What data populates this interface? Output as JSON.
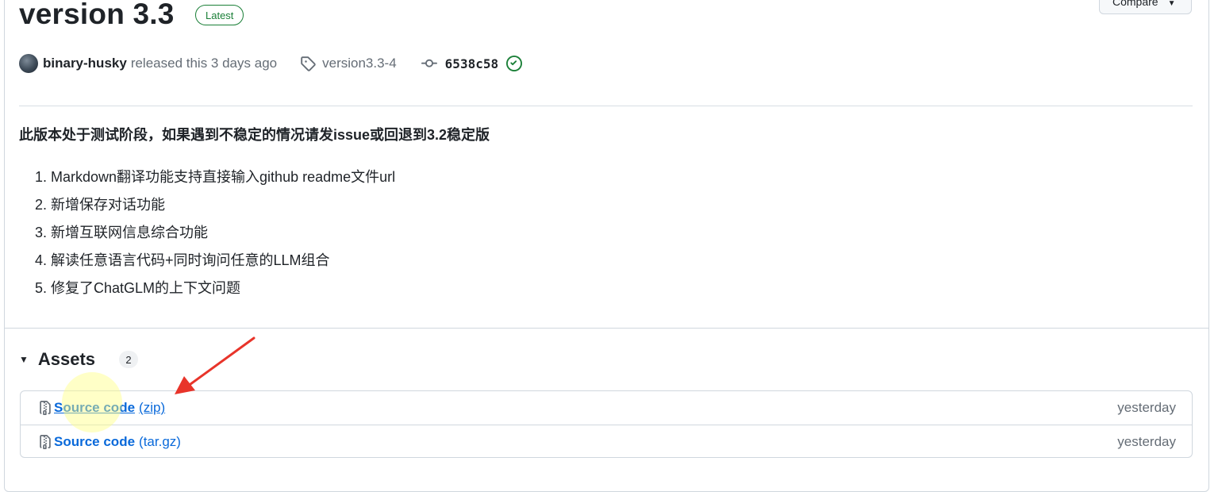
{
  "release": {
    "title": "version 3.3",
    "badge": "Latest",
    "compare_label": "Compare",
    "author": "binary-husky",
    "released_text": "released this 3 days ago",
    "tag": "version3.3-4",
    "commit": "6538c58"
  },
  "notes": {
    "notice": "此版本处于测试阶段，如果遇到不稳定的情况请发issue或回退到3.2稳定版",
    "items": [
      "1. Markdown翻译功能支持直接输入github readme文件url",
      "2. 新增保存对话功能",
      "3. 新增互联网信息综合功能",
      "4. 解读任意语言代码+同时询问任意的LLM组合",
      "5. 修复了ChatGLM的上下文问题"
    ]
  },
  "assets": {
    "title": "Assets",
    "count": "2",
    "items": [
      {
        "name": "Source code",
        "ext": "(zip)",
        "date": "yesterday",
        "icon": "file-zip-icon"
      },
      {
        "name": "Source code",
        "ext": "(tar.gz)",
        "date": "yesterday",
        "icon": "file-zip-icon"
      }
    ]
  },
  "colors": {
    "link": "#0969da",
    "success": "#1a7f37",
    "annotation_arrow": "#e8342a",
    "highlight": "#ffff82"
  }
}
